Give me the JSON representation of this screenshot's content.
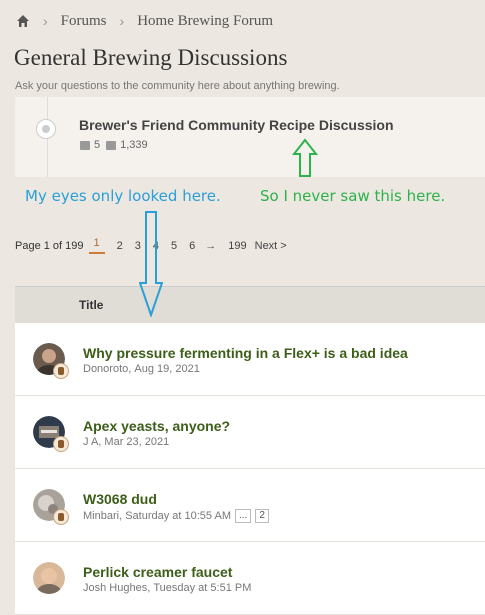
{
  "breadcrumb": {
    "items": [
      "Forums",
      "Home Brewing Forum"
    ],
    "separator": "›"
  },
  "page": {
    "title": "General Brewing Discussions",
    "description": "Ask your questions to the community here about anything brewing."
  },
  "sticky_thread": {
    "title": "Brewer's Friend Community Recipe Discussion",
    "replies": "5",
    "views": "1,339"
  },
  "annotations": {
    "blue_text": "My eyes only looked here.",
    "green_text": "So I never saw this here.",
    "blue_color": "#2a9fd8",
    "green_color": "#2db34a"
  },
  "pagination": {
    "label": "Page 1 of 199",
    "pages": [
      "1",
      "2",
      "3",
      "4",
      "5",
      "6"
    ],
    "ellipsis_arrow": "→",
    "last": "199",
    "next": "Next >",
    "current": "1"
  },
  "list": {
    "header": "Title"
  },
  "threads": [
    {
      "title": "Why pressure fermenting in a Flex+ is a bad idea",
      "author": "Donoroto",
      "date": "Aug 19, 2021"
    },
    {
      "title": "Apex yeasts, anyone?",
      "author": "J A",
      "date": "Mar 23, 2021"
    },
    {
      "title": "W3068 dud",
      "author": "Minbari",
      "date": "Saturday at 10:55 AM",
      "mini_pages": [
        "...",
        "2"
      ]
    },
    {
      "title": "Perlick creamer faucet",
      "author": "Josh Hughes",
      "date": "Tuesday at 5:51 PM"
    }
  ],
  "colors": {
    "thread_title": "#3d5e18",
    "active_page": "#d07b3a"
  }
}
